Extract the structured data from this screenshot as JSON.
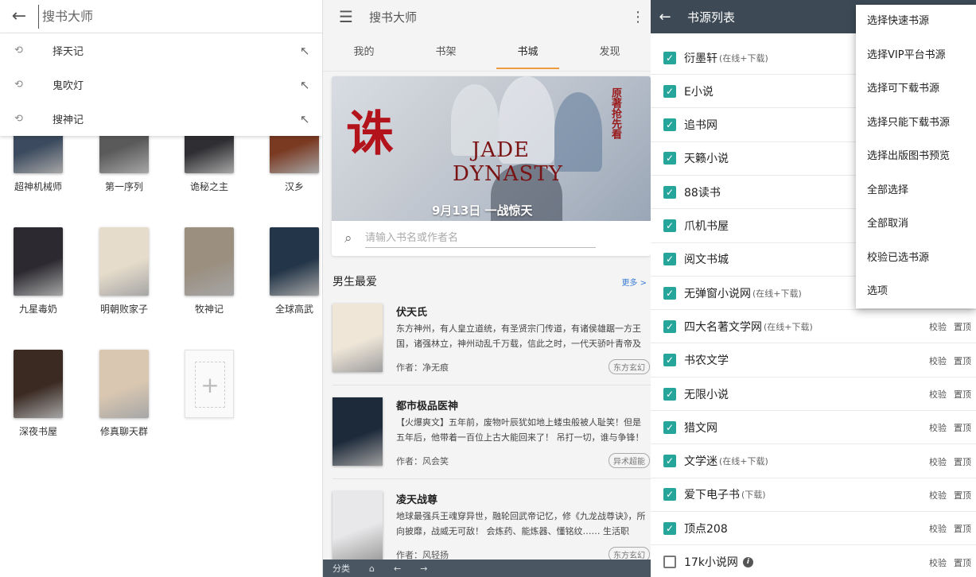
{
  "panel1": {
    "search_placeholder": "搜书大师",
    "back_icon": "arrow-left-icon",
    "history": [
      {
        "label": "择天记"
      },
      {
        "label": "鬼吹灯"
      },
      {
        "label": "搜神记"
      }
    ],
    "bookshelf": [
      {
        "title": "超神机械师",
        "color": "#3b4a5e"
      },
      {
        "title": "第一序列",
        "color": "#5a5a5a"
      },
      {
        "title": "诡秘之主",
        "color": "#2f2f33"
      },
      {
        "title": "汉乡",
        "color": "#7a3a22"
      },
      {
        "title": "九星毒奶",
        "color": "#2c2a30"
      },
      {
        "title": "明朝败家子",
        "color": "#e6dccb"
      },
      {
        "title": "牧神记",
        "color": "#9b8f80"
      },
      {
        "title": "全球高武",
        "color": "#233548"
      },
      {
        "title": "深夜书屋",
        "color": "#3a2a22"
      },
      {
        "title": "修真聊天群",
        "color": "#d9c7b1"
      }
    ]
  },
  "panel2": {
    "title": "搜书大师",
    "tabs": [
      {
        "label": "我的"
      },
      {
        "label": "书架"
      },
      {
        "label": "书城"
      },
      {
        "label": "发现"
      }
    ],
    "banner": {
      "red_title": "诛",
      "subtitle": "原著抢先看",
      "title_line1": "JADE",
      "title_line2": "DYNASTY",
      "date_text": "9月13日 一战惊天"
    },
    "search_placeholder": "请输入书名或作者名",
    "section_title": "男生最爱",
    "section_more": "更多 >",
    "feed": [
      {
        "name": "伏天氏",
        "desc": "东方神州，有人皇立道统，有圣贤宗门传道，有诸侯雄踞一方王国，诸强林立，神州动乱千万载，信此之时，一代天骄叶青帝及东...",
        "author": "作者：净无痕",
        "tag": "东方玄幻",
        "cover": "#efe6d8"
      },
      {
        "name": "都市极品医神",
        "desc": "【火爆爽文】五年前，废物叶辰犹如地上蝼虫般被人耻笑！但是五年后，他带着一百位上古大能回来了！ 吊打一切，谁与争锋！",
        "author": "作者：风会笑",
        "tag": "异术超能",
        "cover": "#1d2a3a"
      },
      {
        "name": "凌天战尊",
        "desc": "地球最强兵王魂穿异世，融轮回武帝记忆，修《九龙战尊诀》，所向披靡，战威无可敌！ 会炼药、能炼器、懂铭纹…… 生活职业，...",
        "author": "作者：风轻扬",
        "tag": "东方玄幻",
        "cover": "#e8e8ea"
      }
    ],
    "bottombar": [
      "分类",
      "⌂",
      "←",
      "→"
    ]
  },
  "panel3": {
    "title": "书源列表",
    "sources": [
      {
        "name": "衍墨轩",
        "note": "(在线+下载)",
        "checked": true
      },
      {
        "name": "E小说",
        "note": "",
        "checked": true
      },
      {
        "name": "追书网",
        "note": "",
        "checked": true
      },
      {
        "name": "天籁小说",
        "note": "",
        "checked": true
      },
      {
        "name": "88读书",
        "note": "",
        "checked": true
      },
      {
        "name": "爪机书屋",
        "note": "",
        "checked": true
      },
      {
        "name": "阅文书城",
        "note": "",
        "checked": true
      },
      {
        "name": "无弹窗小说网",
        "note": "(在线+下载)",
        "checked": true
      },
      {
        "name": "四大名著文学网",
        "note": "(在线+下载)",
        "checked": true
      },
      {
        "name": "书农文学",
        "note": "",
        "checked": true
      },
      {
        "name": "无限小说",
        "note": "",
        "checked": true
      },
      {
        "name": "猎文网",
        "note": "",
        "checked": true
      },
      {
        "name": "文学迷",
        "note": "(在线+下载)",
        "checked": true
      },
      {
        "name": "爱下电子书",
        "note": "(下载)",
        "checked": true
      },
      {
        "name": "顶点208",
        "note": "",
        "checked": true
      },
      {
        "name": "17k小说网",
        "note": "",
        "checked": false,
        "info": true
      }
    ],
    "verify_label": "校验",
    "pin_label": "置顶",
    "menu": [
      {
        "label": "选择快速书源"
      },
      {
        "label": "选择VIP平台书源"
      },
      {
        "label": "选择可下载书源"
      },
      {
        "label": "选择只能下载书源"
      },
      {
        "label": "选择出版图书预览"
      },
      {
        "label": "全部选择"
      },
      {
        "label": "全部取消"
      },
      {
        "label": "校验已选书源"
      },
      {
        "label": "选项"
      }
    ]
  }
}
